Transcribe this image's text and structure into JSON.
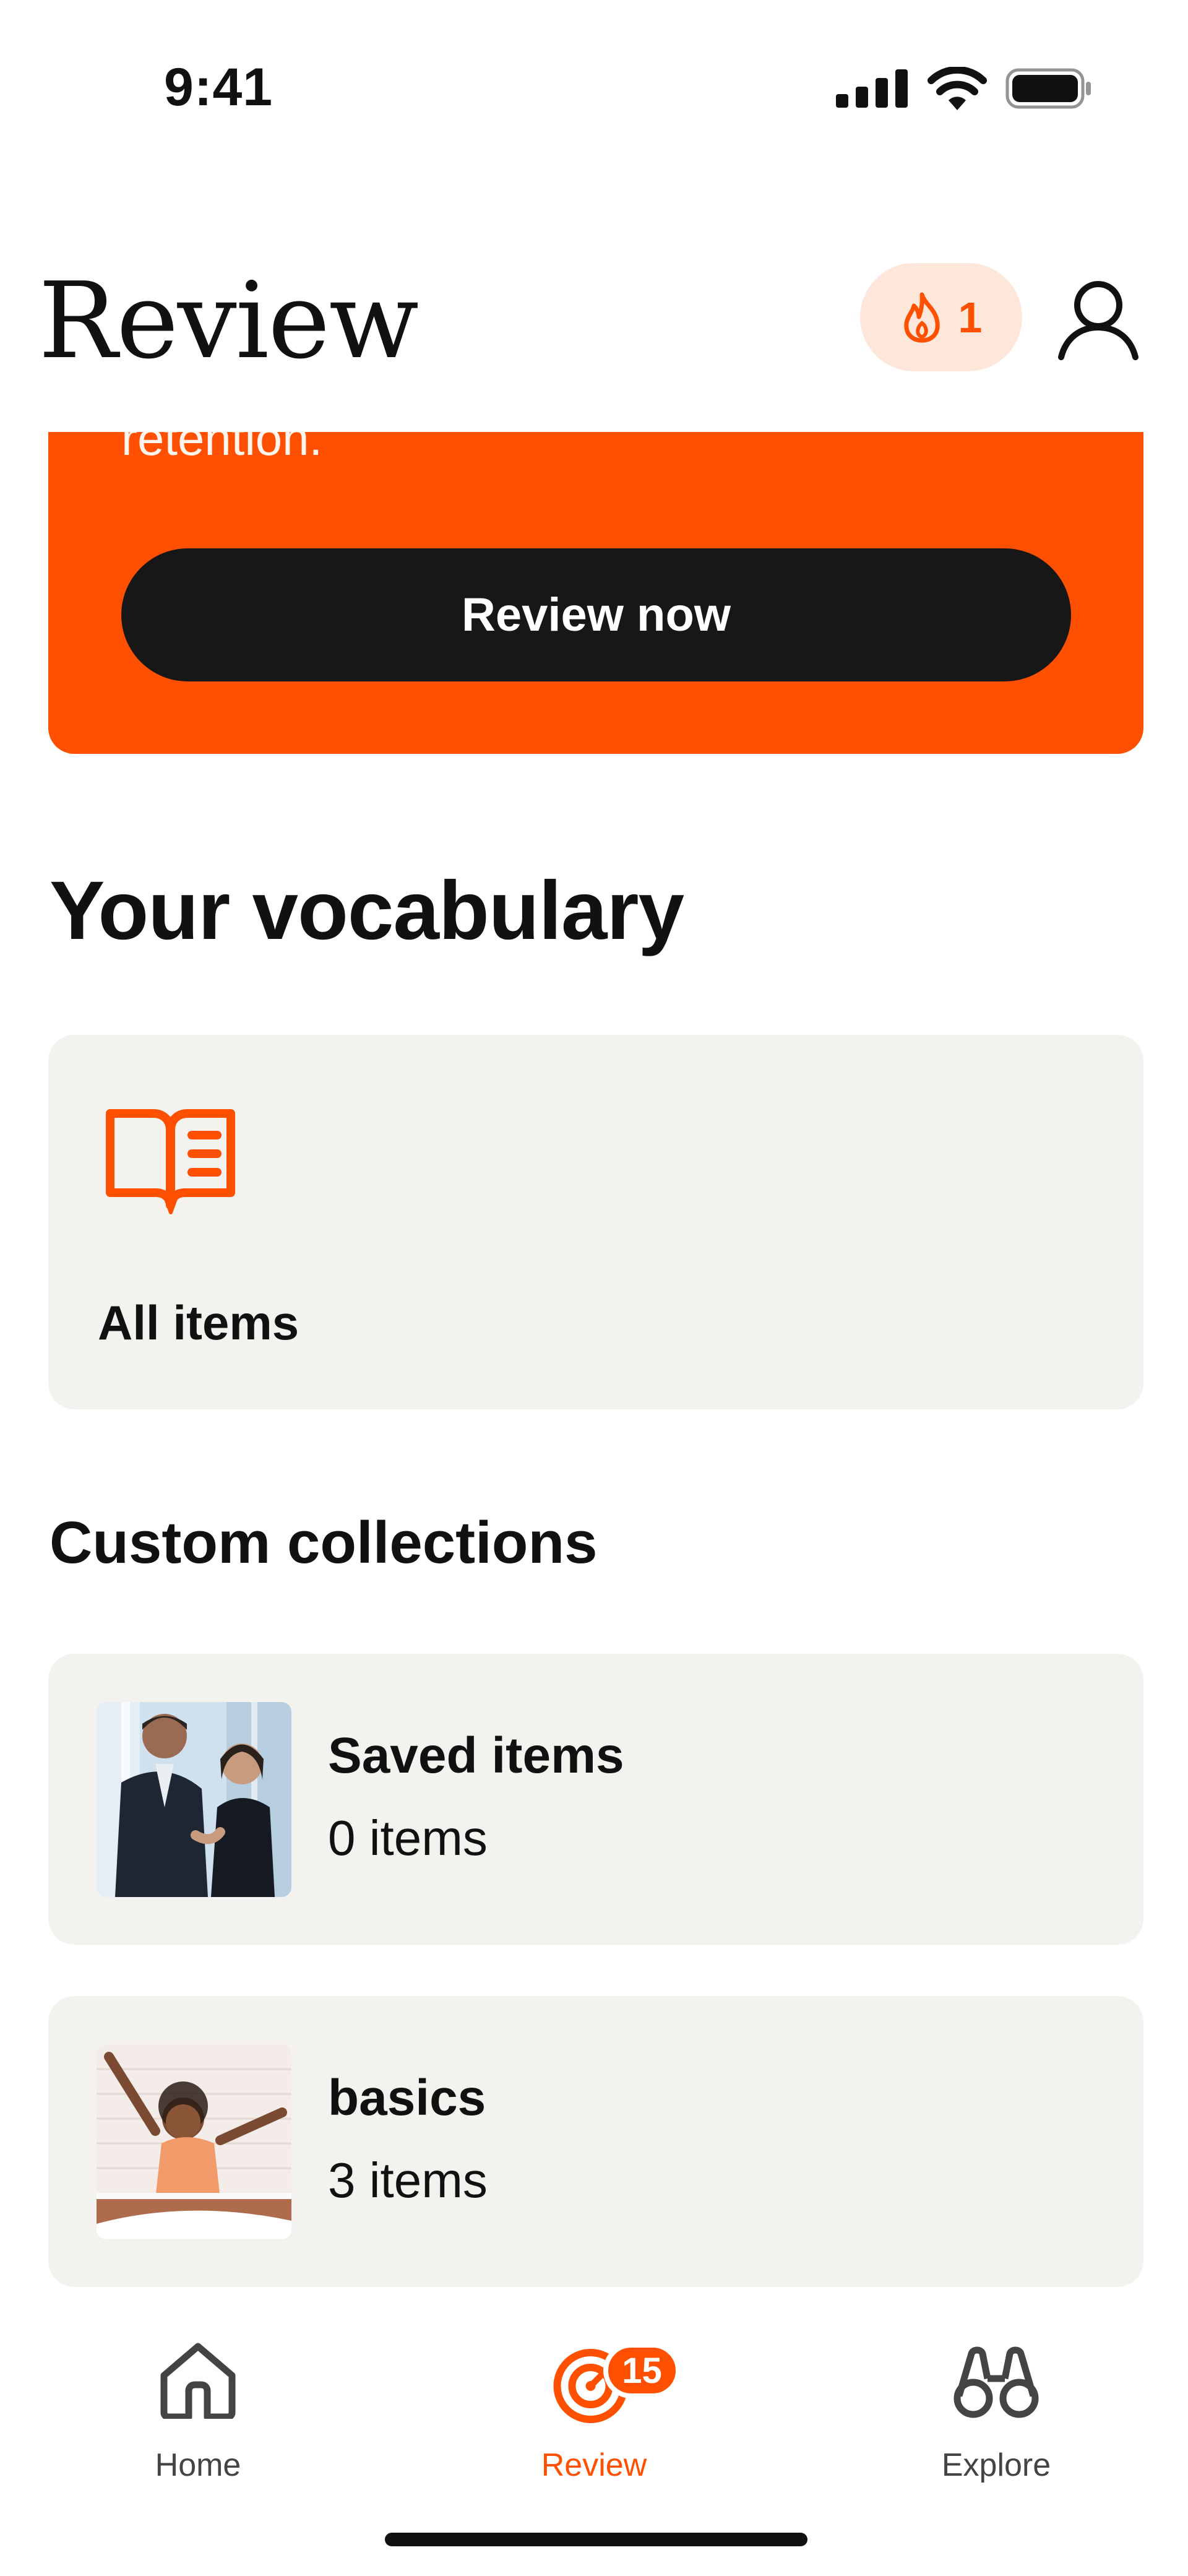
{
  "status_bar": {
    "time": "9:41",
    "icons": [
      "cellular-signal-icon",
      "wifi-icon",
      "battery-icon"
    ]
  },
  "header": {
    "title": "Review",
    "streak_count": "1",
    "icons": [
      "flame-icon",
      "profile-icon"
    ]
  },
  "banner": {
    "text_visible": "retention.",
    "button_label": "Review now",
    "background_color": "#fe5000",
    "button_color": "#171717"
  },
  "vocabulary": {
    "title": "Your vocabulary",
    "all_items": {
      "label": "All items",
      "icon": "open-book-icon"
    }
  },
  "custom_collections": {
    "title": "Custom collections",
    "items": [
      {
        "name": "Saved items",
        "count": "0 items",
        "thumbnail": "business-people-handshake-photo"
      },
      {
        "name": "basics",
        "count": "3 items",
        "thumbnail": "woman-stretching-in-bed-photo"
      }
    ]
  },
  "tab_bar": {
    "tabs": [
      {
        "label": "Home",
        "icon": "home-icon",
        "active": false
      },
      {
        "label": "Review",
        "icon": "target-icon",
        "active": true,
        "badge": "15"
      },
      {
        "label": "Explore",
        "icon": "binoculars-icon",
        "active": false
      }
    ]
  },
  "colors": {
    "accent": "#fe5000",
    "card_background": "#f4f2ee",
    "streak_pill_background": "#fde6da"
  }
}
